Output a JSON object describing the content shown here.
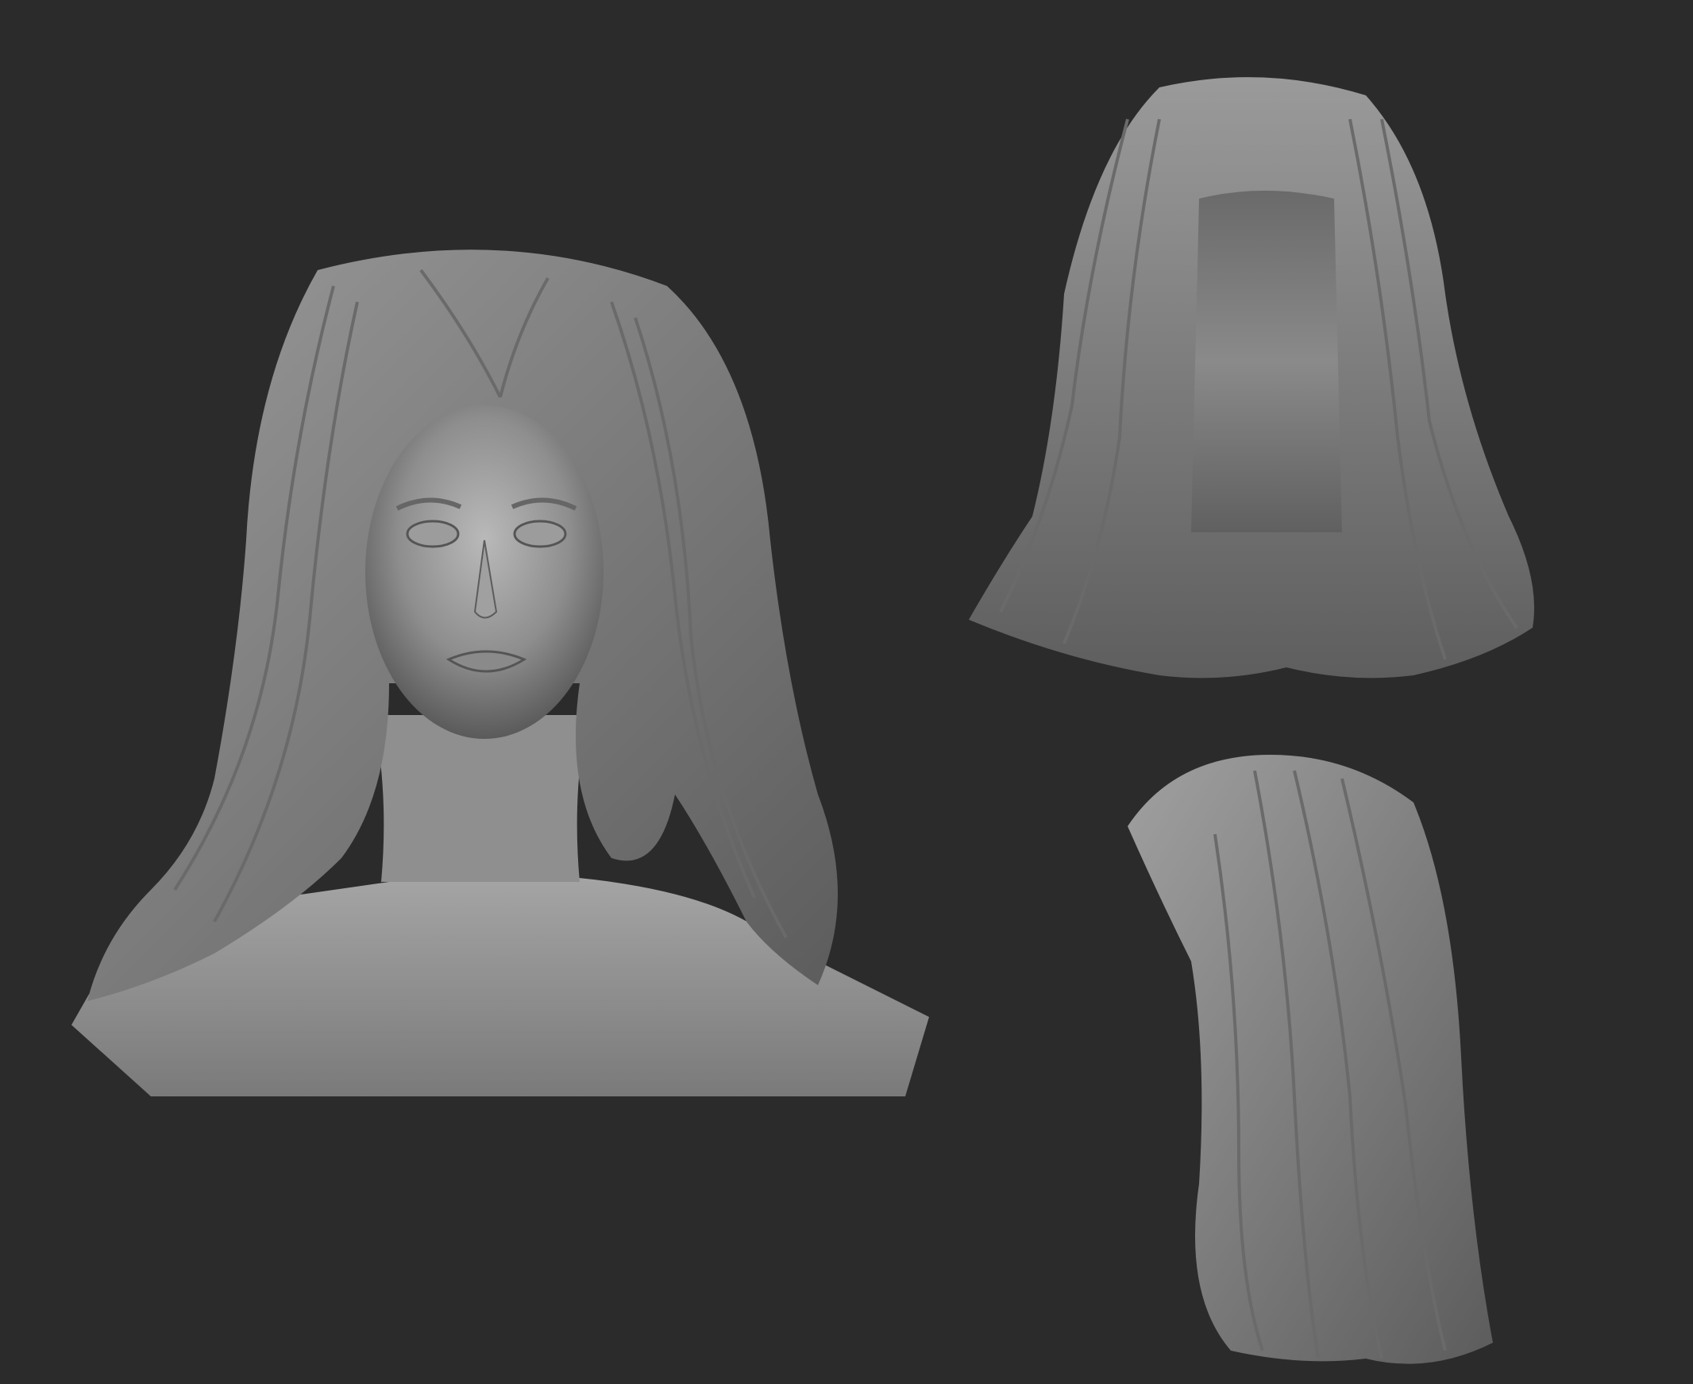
{
  "scene": {
    "background_color": "#2b2b2b",
    "clay_color": "#8a8a8a",
    "clay_highlight": "#b8b8b8",
    "clay_shadow": "#4a4a4a"
  },
  "views": [
    {
      "name": "front-bust",
      "description_icon": "sculpted-bust-front"
    },
    {
      "name": "hair-back",
      "description_icon": "sculpted-hair-back"
    },
    {
      "name": "hair-side",
      "description_icon": "sculpted-hair-side"
    }
  ]
}
